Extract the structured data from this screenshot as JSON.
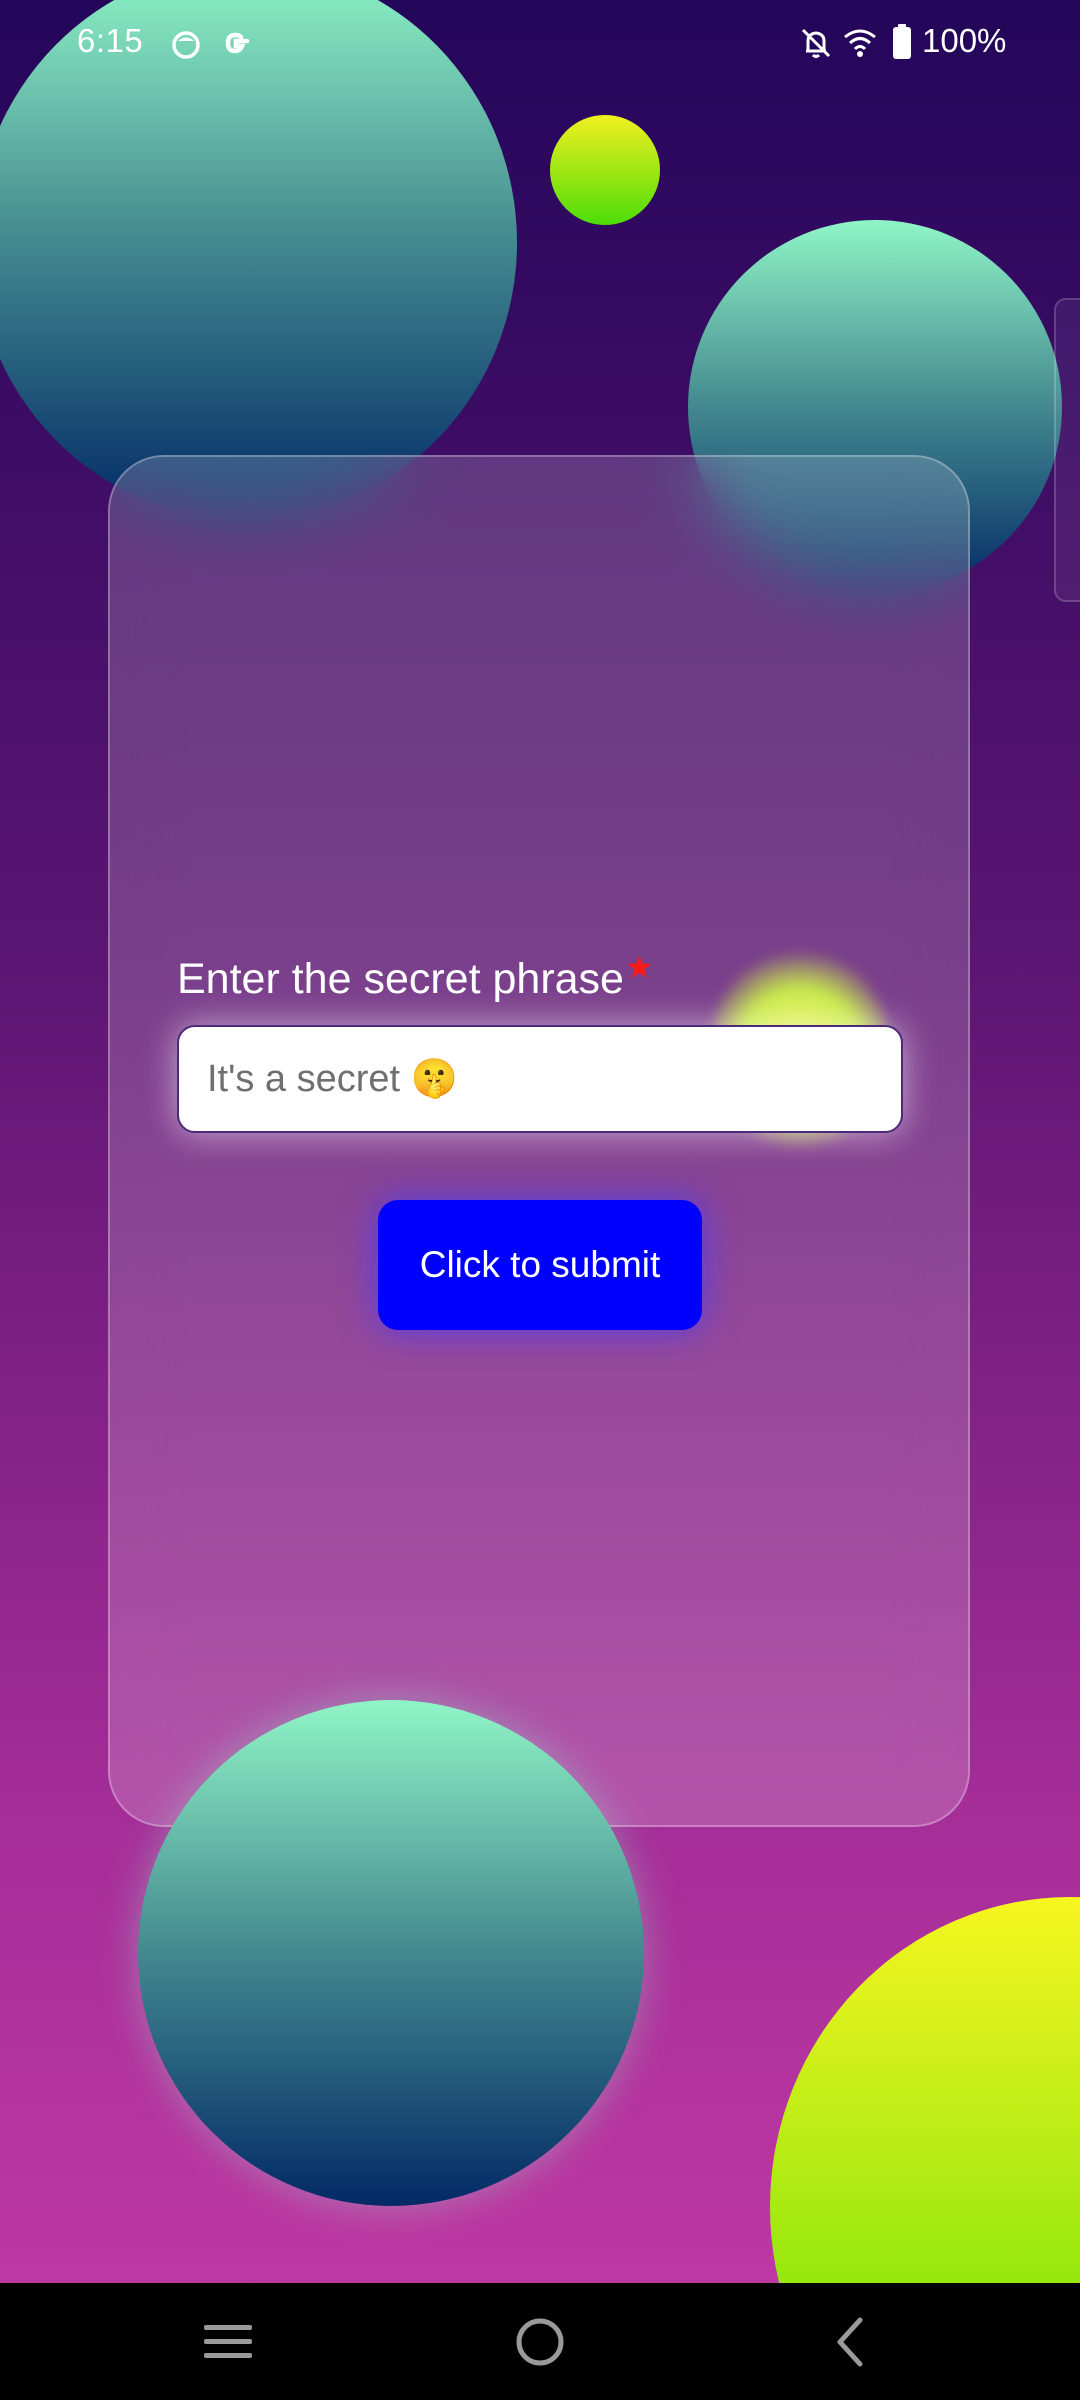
{
  "status_bar": {
    "time": "6:15",
    "battery_percent": "100%",
    "icons": [
      "app-notification-icon",
      "google-icon",
      "bell-off-icon",
      "wifi-icon",
      "battery-icon"
    ]
  },
  "form": {
    "label": "Enter the secret phrase",
    "required_marker": "★",
    "input_placeholder": "It's a secret 🤫",
    "input_value": "",
    "submit_label": "Click to submit"
  },
  "nav_bar": {
    "buttons": [
      "recents-icon",
      "home-icon",
      "back-icon"
    ]
  },
  "colors": {
    "background_top": "#23065a",
    "background_bottom": "#c53aa5",
    "submit_button": "#0000ff",
    "required_star": "#ff1a1a",
    "orb_teal_top": "#8ff5c6",
    "orb_teal_bottom": "#022a66",
    "orb_lime_top": "#f7f520",
    "orb_lime_bottom": "#68e108"
  }
}
